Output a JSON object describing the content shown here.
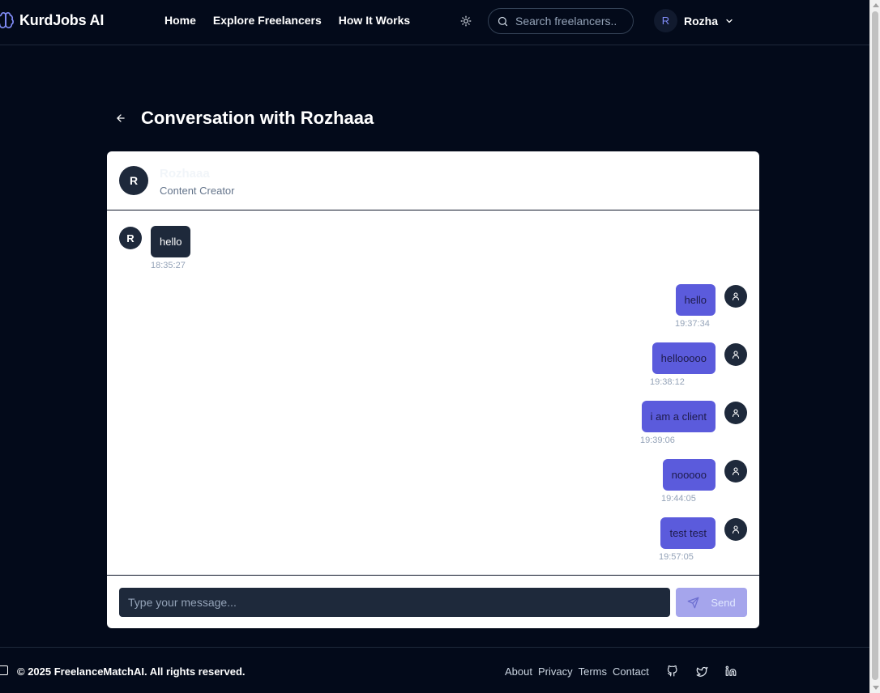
{
  "header": {
    "brand": "KurdJobs AI",
    "nav": [
      "Home",
      "Explore Freelancers",
      "How It Works"
    ],
    "search_placeholder": "Search freelancers..",
    "user_initial": "R",
    "user_name": "Rozha"
  },
  "page": {
    "title": "Conversation with Rozhaaa"
  },
  "contact": {
    "initial": "R",
    "name": "Rozhaaa",
    "role": "Content Creator"
  },
  "messages": [
    {
      "direction": "in",
      "text": "hello",
      "time": "18:35:27",
      "avatar": "R"
    },
    {
      "direction": "out",
      "text": "hello",
      "time": "19:37:34"
    },
    {
      "direction": "out",
      "text": "hellooooo",
      "time": "19:38:12"
    },
    {
      "direction": "out",
      "text": "i am a client",
      "time": "19:39:06"
    },
    {
      "direction": "out",
      "text": "nooooo",
      "time": "19:44:05"
    },
    {
      "direction": "out",
      "text": "test test",
      "time": "19:57:05"
    }
  ],
  "composer": {
    "placeholder": "Type your message...",
    "send_label": "Send"
  },
  "footer": {
    "copyright": "© 2025 FreelanceMatchAI. All rights reserved.",
    "links": [
      "About",
      "Privacy",
      "Terms",
      "Contact"
    ],
    "social_icons": [
      "github-icon",
      "twitter-icon",
      "linkedin-icon"
    ]
  },
  "colors": {
    "background": "#030a1a",
    "accent": "#5b5bdc",
    "incoming_bubble": "#1e293b",
    "send_disabled": "#a5a5ec"
  }
}
